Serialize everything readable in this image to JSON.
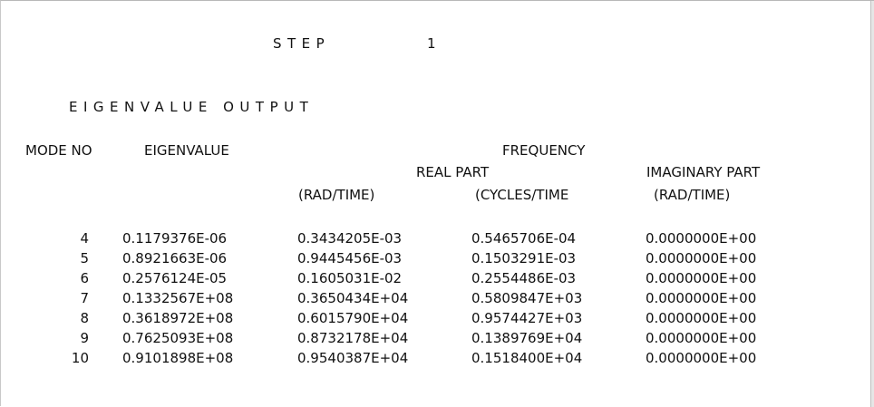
{
  "step": {
    "label": "STEP",
    "number": "1"
  },
  "section_title": "EIGENVALUE OUTPUT",
  "headers": {
    "mode_no": "MODE NO",
    "eigenvalue": "EIGENVALUE",
    "frequency": "FREQUENCY",
    "real_part": "REAL PART",
    "imaginary_part": "IMAGINARY PART",
    "rad_time_1": "(RAD/TIME)",
    "cycles_time": "(CYCLES/TIME",
    "rad_time_2": "(RAD/TIME)"
  },
  "rows": [
    {
      "mode": "4",
      "eigenvalue": "0.1179376E-06",
      "rad": "0.3434205E-03",
      "cycles": "0.5465706E-04",
      "imag": "0.0000000E+00"
    },
    {
      "mode": "5",
      "eigenvalue": "0.8921663E-06",
      "rad": "0.9445456E-03",
      "cycles": "0.1503291E-03",
      "imag": "0.0000000E+00"
    },
    {
      "mode": "6",
      "eigenvalue": "0.2576124E-05",
      "rad": "0.1605031E-02",
      "cycles": "0.2554486E-03",
      "imag": "0.0000000E+00"
    },
    {
      "mode": "7",
      "eigenvalue": "0.1332567E+08",
      "rad": "0.3650434E+04",
      "cycles": "0.5809847E+03",
      "imag": "0.0000000E+00"
    },
    {
      "mode": "8",
      "eigenvalue": "0.3618972E+08",
      "rad": "0.6015790E+04",
      "cycles": "0.9574427E+03",
      "imag": "0.0000000E+00"
    },
    {
      "mode": "9",
      "eigenvalue": "0.7625093E+08",
      "rad": "0.8732178E+04",
      "cycles": "0.1389769E+04",
      "imag": "0.0000000E+00"
    },
    {
      "mode": "10",
      "eigenvalue": "0.9101898E+08",
      "rad": "0.9540387E+04",
      "cycles": "0.1518400E+04",
      "imag": "0.0000000E+00"
    }
  ]
}
